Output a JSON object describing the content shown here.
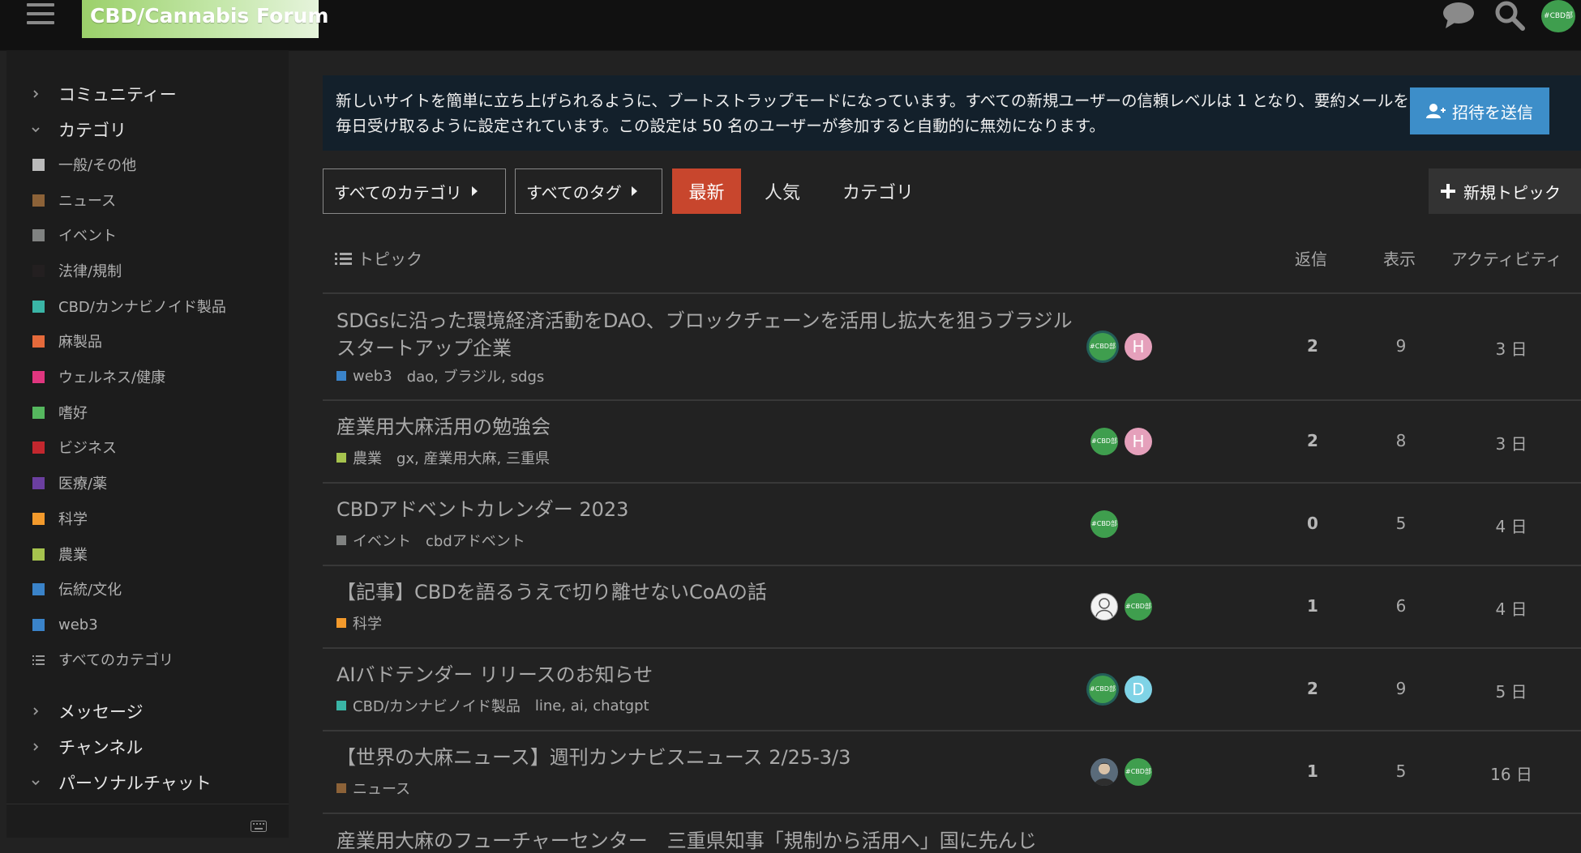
{
  "header": {
    "logo_text": "CBD/Cannabis Forum",
    "avatar_text": "#CBD部",
    "icons": [
      "hamburger-menu-icon",
      "chat-bubble-icon",
      "search-icon"
    ]
  },
  "sidebar": {
    "community_label": "コミュニティー",
    "categories_label": "カテゴリ",
    "categories": [
      {
        "label": "一般/その他",
        "color": "#bbbbbb"
      },
      {
        "label": "ニュース",
        "color": "#8c6238"
      },
      {
        "label": "イベント",
        "color": "#808281"
      },
      {
        "label": "法律/規制",
        "color": "#231f20"
      },
      {
        "label": "CBD/カンナビノイド製品",
        "color": "#3ab5a6"
      },
      {
        "label": "麻製品",
        "color": "#e56a3b"
      },
      {
        "label": "ウェルネス/健康",
        "color": "#e0367f"
      },
      {
        "label": "嗜好",
        "color": "#55b75e"
      },
      {
        "label": "ビジネス",
        "color": "#c3272e"
      },
      {
        "label": "医療/薬",
        "color": "#6b3fa0"
      },
      {
        "label": "科学",
        "color": "#f39a2c"
      },
      {
        "label": "農業",
        "color": "#a6c34e"
      },
      {
        "label": "伝統/文化",
        "color": "#3a83c9"
      },
      {
        "label": "web3",
        "color": "#3a83c9"
      }
    ],
    "all_categories_label": "すべてのカテゴリ",
    "messages_label": "メッセージ",
    "channels_label": "チャンネル",
    "personal_chat_label": "パーソナルチャット"
  },
  "banner": {
    "text": "新しいサイトを簡単に立ち上げられるように、ブートストラップモードになっています。すべての新規ユーザーの信頼レベルは 1 となり、要約メールを毎日受け取るように設定されています。この設定は 50 名のユーザーが参加すると自動的に無効になります。",
    "invite_label": "招待を送信"
  },
  "nav": {
    "all_categories": "すべてのカテゴリ",
    "all_tags": "すべてのタグ",
    "latest": "最新",
    "top": "人気",
    "categories": "カテゴリ",
    "new_topic": "新規トピック"
  },
  "table": {
    "headers": {
      "topic": "トピック",
      "replies": "返信",
      "views": "表示",
      "activity": "アクティビティ"
    }
  },
  "topics": [
    {
      "title": "SDGsに沿った環境経済活動をDAO、ブロックチェーンを活用し拡大を狙うブラジルスタートアップ企業",
      "category": "web3",
      "category_color": "#3a83c9",
      "tags": "dao, ブラジル, sdgs",
      "posters": [
        {
          "type": "cbd",
          "text": "#CBD部",
          "ring": true
        },
        {
          "type": "letter",
          "text": "H",
          "color": "#e5a0bb"
        }
      ],
      "replies": "2",
      "views": "9",
      "activity": "3 日"
    },
    {
      "title": "産業用大麻活用の勉強会",
      "category": "農業",
      "category_color": "#a6c34e",
      "tags": "gx, 産業用大麻, 三重県",
      "posters": [
        {
          "type": "cbd",
          "text": "#CBD部",
          "ring": false
        },
        {
          "type": "letter",
          "text": "H",
          "color": "#e5a0bb"
        }
      ],
      "replies": "2",
      "views": "8",
      "activity": "3 日"
    },
    {
      "title": "CBDアドベントカレンダー 2023",
      "category": "イベント",
      "category_color": "#808281",
      "tags": "cbdアドベント",
      "posters": [
        {
          "type": "cbd",
          "text": "#CBD部",
          "ring": false
        }
      ],
      "replies": "0",
      "views": "5",
      "activity": "4 日"
    },
    {
      "title": "【記事】CBDを語るうえで切り離せないCoAの話",
      "category": "科学",
      "category_color": "#f39a2c",
      "tags": "",
      "posters": [
        {
          "type": "photo",
          "text": "",
          "color": "#f2f2f2"
        },
        {
          "type": "cbd",
          "text": "#CBD部",
          "ring": false
        }
      ],
      "replies": "1",
      "views": "6",
      "activity": "4 日"
    },
    {
      "title": "AIバドテンダー リリースのお知らせ",
      "category": "CBD/カンナビノイド製品",
      "category_color": "#3ab5a6",
      "tags": "line, ai, chatgpt",
      "posters": [
        {
          "type": "cbd",
          "text": "#CBD部",
          "ring": true
        },
        {
          "type": "letter",
          "text": "D",
          "color": "#7fd3e6"
        }
      ],
      "replies": "2",
      "views": "9",
      "activity": "5 日"
    },
    {
      "title": "【世界の大麻ニュース】週刊カンナビスニュース 2/25-3/3",
      "category": "ニュース",
      "category_color": "#8c6238",
      "tags": "",
      "posters": [
        {
          "type": "photo",
          "text": "",
          "color": "#5a6b7a"
        },
        {
          "type": "cbd",
          "text": "#CBD部",
          "ring": false
        }
      ],
      "replies": "1",
      "views": "5",
      "activity": "16 日"
    }
  ],
  "partial_topic_title": "産業用大麻のフューチャーセンター　三重県知事「規制から活用へ」国に先んじ"
}
